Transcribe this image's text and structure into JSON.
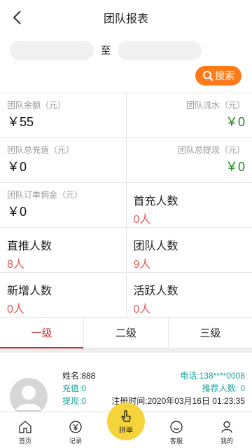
{
  "header": {
    "title": "团队报表"
  },
  "date_filter": {
    "separator": "至",
    "search_label": "搜索"
  },
  "stats": {
    "team_balance_label": "团队余额（元）",
    "team_balance_value": "￥55",
    "team_flow_label": "团队流水（元）",
    "team_flow_value": "￥0",
    "team_recharge_label": "团队总充值（元）",
    "team_recharge_value": "￥0",
    "team_withdraw_label": "团队总提现（元）",
    "team_withdraw_value": "￥0",
    "team_commission_label": "团队订单佣金（元）",
    "team_commission_value": "￥0",
    "first_recharge_label": "首充人数",
    "first_recharge_value": "0人",
    "direct_label": "直推人数",
    "direct_value": "8人",
    "team_count_label": "团队人数",
    "team_count_value": "9人",
    "new_label": "新增人数",
    "new_value": "0人",
    "active_label": "活跃人数",
    "active_value": "0人"
  },
  "tabs": [
    "一级",
    "二级",
    "三级"
  ],
  "member": {
    "name": "姓名:888",
    "phone": "电话:138****0008",
    "recharge": "充值:0",
    "recommend": "推荐人数: 0",
    "withdraw": "提现:0",
    "reg_time": "注册时间:2020年03月16日 01:23:35"
  },
  "tabbar": {
    "home": "首页",
    "records": "记录",
    "center": "拼单",
    "service": "客服",
    "mine": "我的"
  },
  "colors": {
    "accent": "#ff7a1a",
    "active_tab": "#c03030",
    "green": "#1f8a1f",
    "red": "#e05a5a",
    "teal": "#1aa39a",
    "fab": "#f5d33a"
  }
}
